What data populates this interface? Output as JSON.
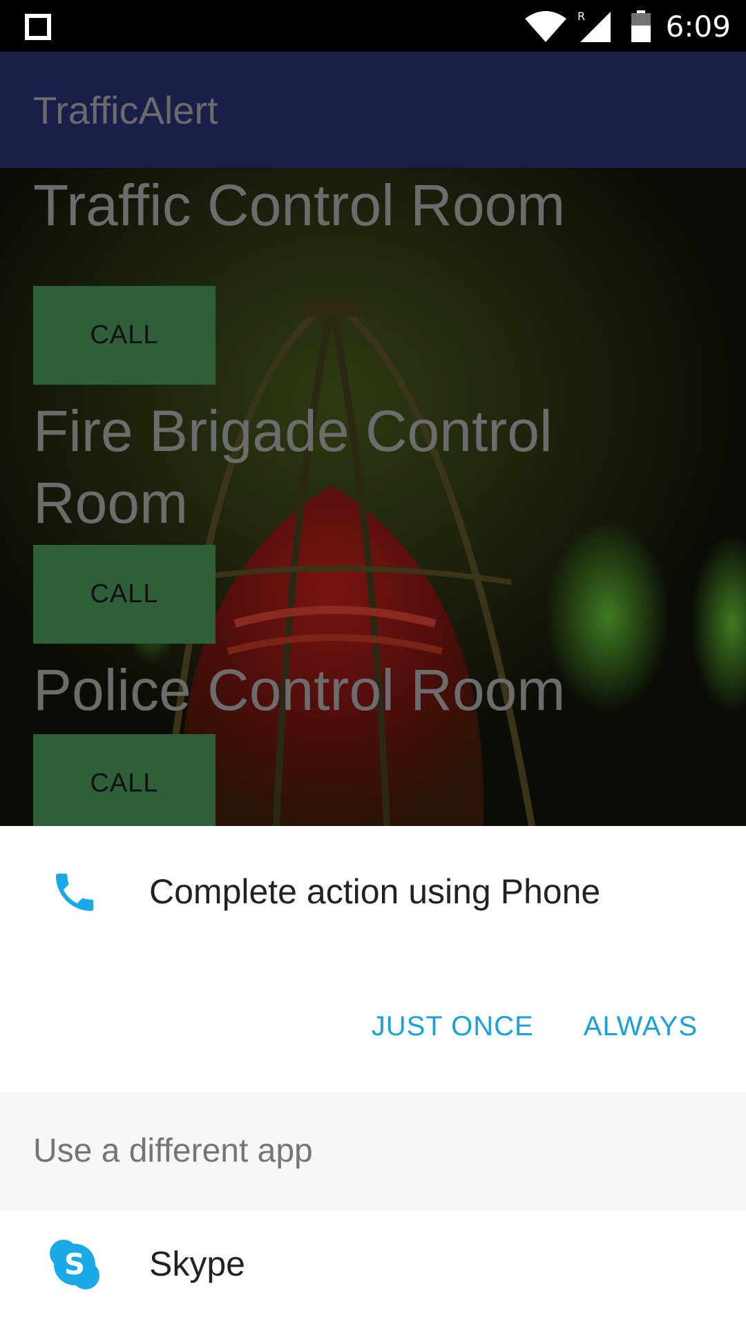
{
  "status_bar": {
    "time": "6:09",
    "roaming_indicator": "R",
    "icons": [
      "square-icon",
      "wifi-icon",
      "signal-icon",
      "battery-icon"
    ]
  },
  "app_bar": {
    "title": "TrafficAlert"
  },
  "rooms": [
    {
      "title": "Traffic Control Room",
      "call_label": "CALL"
    },
    {
      "title": "Fire Brigade Control Room",
      "call_label": "CALL"
    },
    {
      "title": "Police Control Room",
      "call_label": "CALL"
    }
  ],
  "chooser": {
    "title": "Complete action using Phone",
    "just_once_label": "JUST ONCE",
    "always_label": "ALWAYS",
    "alt_label": "Use a different app",
    "apps": [
      {
        "name": "Skype",
        "icon": "skype-icon"
      }
    ]
  },
  "colors": {
    "app_bar": "#1a1f4a",
    "call_button": "#2f5f39",
    "accent": "#1aa1d6",
    "skype": "#1ba8e6"
  }
}
